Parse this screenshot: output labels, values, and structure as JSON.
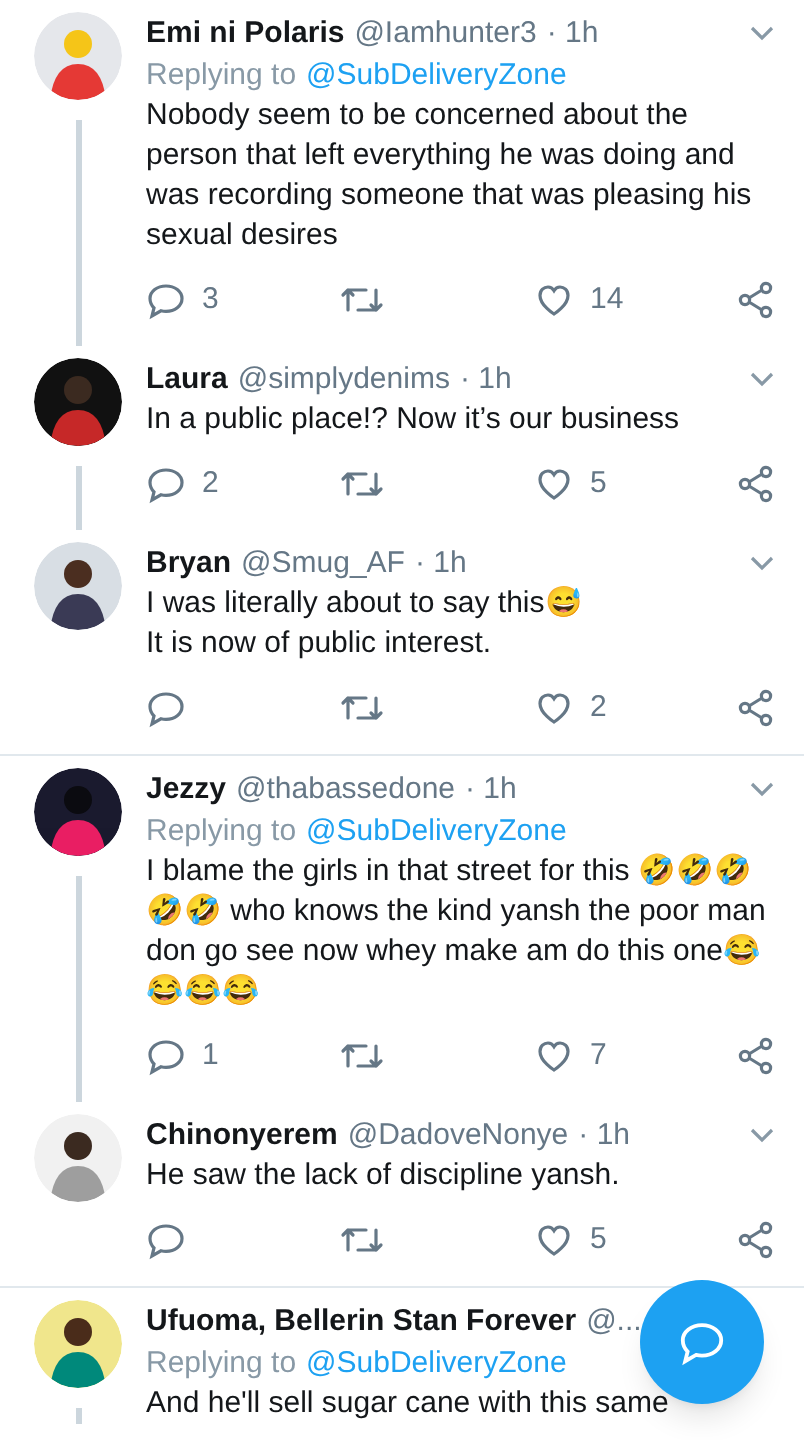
{
  "tweets": [
    {
      "name": "Emi ni Polaris",
      "handle": "@Iamhunter3",
      "time": "· 1h",
      "replying_label": "Replying to",
      "replying_to": "@SubDeliveryZone",
      "text": "Nobody seem to be concerned about the person that left everything he was doing and was recording someone that was pleasing his sexual desires",
      "replies": "3",
      "likes": "14",
      "threaded": true
    },
    {
      "name": "Laura",
      "handle": "@simplydenims",
      "time": "· 1h",
      "text": "In a public place!? Now it’s our business",
      "replies": "2",
      "likes": "5",
      "threaded": true
    },
    {
      "name": "Bryan",
      "handle": "@Smug_AF",
      "time": "· 1h",
      "text": "I was literally about to say this😅\nIt is now of public interest.",
      "likes": "2",
      "threaded": false
    },
    {
      "name": "Jezzy",
      "handle": "@thabassedone",
      "time": "· 1h",
      "replying_label": "Replying to",
      "replying_to": "@SubDeliveryZone",
      "text": "I blame the girls in that street for this 🤣🤣🤣🤣🤣 who knows the kind yansh the poor man don go see now whey make am do this one😂😂😂😂",
      "replies": "1",
      "likes": "7",
      "threaded": true
    },
    {
      "name": "Chinonyerem",
      "handle": "@DadoveNonye",
      "time": "· 1h",
      "text": "He saw the lack of discipline yansh.",
      "likes": "5",
      "threaded": false
    },
    {
      "name": "Ufuoma, Bellerin Stan Forever",
      "handle": "@...",
      "replying_label": "Replying to",
      "replying_to": "@SubDeliveryZone",
      "text": "And he'll sell sugar cane with this same",
      "threaded": true,
      "menu_covered": true
    }
  ]
}
